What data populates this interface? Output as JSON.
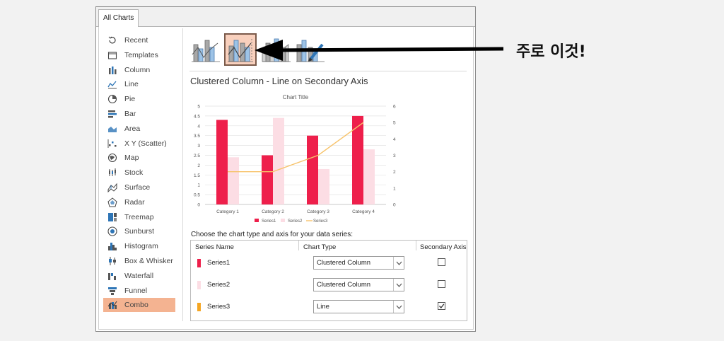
{
  "dialog": {
    "tab_label": "All Charts",
    "sidebar": [
      {
        "label": "Recent",
        "icon": "recent-icon"
      },
      {
        "label": "Templates",
        "icon": "templates-icon"
      },
      {
        "label": "Column",
        "icon": "column-chart-icon"
      },
      {
        "label": "Line",
        "icon": "line-chart-icon"
      },
      {
        "label": "Pie",
        "icon": "pie-chart-icon"
      },
      {
        "label": "Bar",
        "icon": "bar-chart-icon"
      },
      {
        "label": "Area",
        "icon": "area-chart-icon"
      },
      {
        "label": "X Y (Scatter)",
        "icon": "scatter-chart-icon"
      },
      {
        "label": "Map",
        "icon": "map-chart-icon"
      },
      {
        "label": "Stock",
        "icon": "stock-chart-icon"
      },
      {
        "label": "Surface",
        "icon": "surface-chart-icon"
      },
      {
        "label": "Radar",
        "icon": "radar-chart-icon"
      },
      {
        "label": "Treemap",
        "icon": "treemap-chart-icon"
      },
      {
        "label": "Sunburst",
        "icon": "sunburst-chart-icon"
      },
      {
        "label": "Histogram",
        "icon": "histogram-chart-icon"
      },
      {
        "label": "Box & Whisker",
        "icon": "box-whisker-chart-icon"
      },
      {
        "label": "Waterfall",
        "icon": "waterfall-chart-icon"
      },
      {
        "label": "Funnel",
        "icon": "funnel-chart-icon"
      },
      {
        "label": "Combo",
        "icon": "combo-chart-icon",
        "selected": true
      }
    ],
    "combo_thumbnails": [
      {
        "name": "clustered-column-line-thumb",
        "selected": false
      },
      {
        "name": "clustered-column-line-secondary-thumb",
        "selected": true
      },
      {
        "name": "stacked-area-clustered-column-thumb",
        "selected": false
      },
      {
        "name": "custom-combination-thumb",
        "selected": false
      }
    ],
    "combo_title": "Clustered Column - Line on Secondary Axis",
    "choose_label": "Choose the chart type and axis for your data series:",
    "table": {
      "headers": [
        "Series Name",
        "Chart Type",
        "Secondary Axis"
      ],
      "rows": [
        {
          "name": "Series1",
          "type": "Clustered Column",
          "secondary": false,
          "color": "#ee1f4b"
        },
        {
          "name": "Series2",
          "type": "Clustered Column",
          "secondary": false,
          "color": "#fcdde4"
        },
        {
          "name": "Series3",
          "type": "Line",
          "secondary": true,
          "color": "#f5a623"
        }
      ]
    }
  },
  "annotation": "주로 이것!",
  "chart_data": {
    "type": "bar",
    "title": "Chart Title",
    "categories": [
      "Category 1",
      "Category 2",
      "Category 3",
      "Category 4"
    ],
    "series": [
      {
        "name": "Series1",
        "kind": "column",
        "axis": "primary",
        "values": [
          4.3,
          2.5,
          3.5,
          4.5
        ],
        "color": "#ee1f4b"
      },
      {
        "name": "Series2",
        "kind": "column",
        "axis": "primary",
        "values": [
          2.4,
          4.4,
          1.8,
          2.8
        ],
        "color": "#fcdde4"
      },
      {
        "name": "Series3",
        "kind": "line",
        "axis": "secondary",
        "values": [
          2,
          2,
          3,
          5
        ],
        "color": "#f7c36b"
      }
    ],
    "y_primary": {
      "range": [
        0,
        5
      ],
      "ticks": [
        "0",
        "0.5",
        "1",
        "1.5",
        "2",
        "2.5",
        "3",
        "3.5",
        "4",
        "4.5",
        "5"
      ]
    },
    "y_secondary": {
      "range": [
        0,
        6
      ],
      "ticks": [
        "0",
        "1",
        "2",
        "3",
        "4",
        "5",
        "6"
      ]
    },
    "grid": true,
    "legend": "bottom"
  }
}
